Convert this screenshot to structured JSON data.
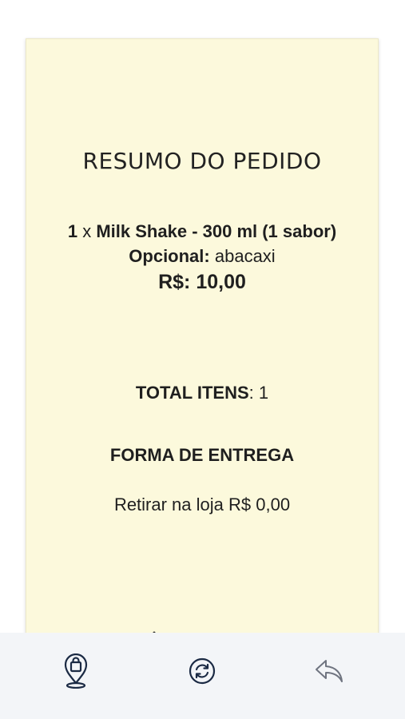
{
  "summary": {
    "title": "RESUMO DO PEDIDO",
    "item": {
      "quantity": "1",
      "times": "x",
      "name": "Milk Shake - 300 ml (1 sabor)",
      "optional_label": "Opcional:",
      "optional_value": "abacaxi",
      "price": "R$: 10,00"
    },
    "total_label": "TOTAL ITENS",
    "total_value": ": 1",
    "delivery_heading": "FORMA DE ENTREGA",
    "delivery_value": "Retirar na loja R$ 0,00"
  },
  "bottom_nav": {
    "icons": [
      "store-location-icon",
      "refresh-icon",
      "back-icon"
    ]
  },
  "colors": {
    "receipt_background": "#fcf9dc",
    "nav_icon_dark": "#1b2a44",
    "nav_icon_muted": "#6f7480",
    "bottom_bar": "#f3f5f8"
  }
}
